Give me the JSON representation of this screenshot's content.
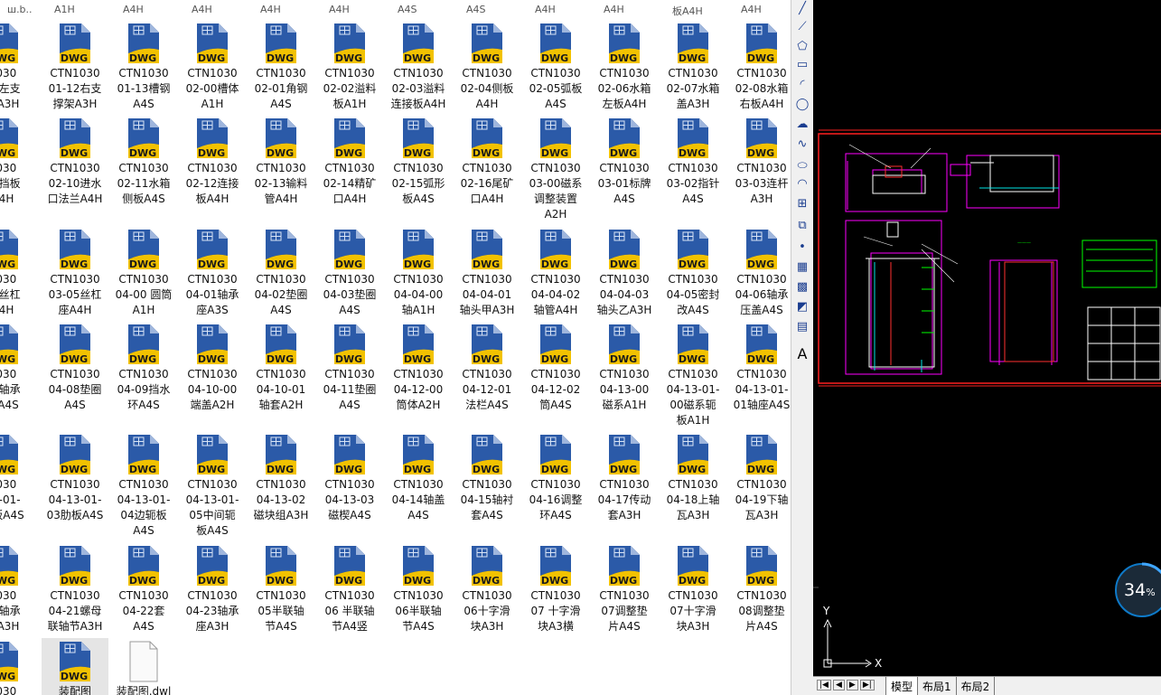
{
  "top_strip": [
    "ш.b..",
    "A1H",
    "A4H",
    "A4H",
    "A4H",
    "A4H",
    "A4S",
    "A4S",
    "A4H",
    "A4H",
    "板A4H",
    "A4H"
  ],
  "files": [
    [
      "1030",
      "11左支",
      "架A3H"
    ],
    [
      "CTN1030",
      "01-12右支",
      "撑架A3H"
    ],
    [
      "CTN1030",
      "01-13槽钢",
      "A4S"
    ],
    [
      "CTN1030",
      "02-00槽体",
      "A1H"
    ],
    [
      "CTN1030",
      "02-01角钢",
      "A4S"
    ],
    [
      "CTN1030",
      "02-02溢料",
      "板A1H"
    ],
    [
      "CTN1030",
      "02-03溢料",
      "连接板A4H"
    ],
    [
      "CTN1030",
      "02-04侧板",
      "A4H"
    ],
    [
      "CTN1030",
      "02-05弧板",
      "A4S"
    ],
    [
      "CTN1030",
      "02-06水箱",
      "左板A4H"
    ],
    [
      "CTN1030",
      "02-07水箱",
      "盖A3H"
    ],
    [
      "CTN1030",
      "02-08水箱",
      "右板A4H"
    ],
    [
      "1030",
      "09挡板",
      "A4H"
    ],
    [
      "CTN1030",
      "02-10进水",
      "口法兰A4H"
    ],
    [
      "CTN1030",
      "02-11水箱",
      "侧板A4S"
    ],
    [
      "CTN1030",
      "02-12连接",
      "板A4H"
    ],
    [
      "CTN1030",
      "02-13输料",
      "管A4H"
    ],
    [
      "CTN1030",
      "02-14精矿",
      "口A4H"
    ],
    [
      "CTN1030",
      "02-15弧形",
      "板A4S"
    ],
    [
      "CTN1030",
      "02-16尾矿",
      "口A4H"
    ],
    [
      "CTN1030",
      "03-00磁系",
      "调整装置",
      "A2H"
    ],
    [
      "CTN1030",
      "03-01标牌",
      "A4S"
    ],
    [
      "CTN1030",
      "03-02指针",
      "A4S"
    ],
    [
      "CTN1030",
      "03-03连杆",
      "A3H"
    ],
    [
      "1030",
      "04丝杠",
      "A4H"
    ],
    [
      "CTN1030",
      "03-05丝杠",
      "座A4H"
    ],
    [
      "CTN1030",
      "04-00 圆筒",
      "A1H"
    ],
    [
      "CTN1030",
      "04-01轴承",
      "座A3S"
    ],
    [
      "CTN1030",
      "04-02垫圈",
      "A4S"
    ],
    [
      "CTN1030",
      "04-03垫圈",
      "A4S"
    ],
    [
      "CTN1030",
      "04-04-00",
      "轴A1H"
    ],
    [
      "CTN1030",
      "04-04-01",
      "轴头甲A3H"
    ],
    [
      "CTN1030",
      "04-04-02",
      "轴管A4H"
    ],
    [
      "CTN1030",
      "04-04-03",
      "轴头乙A3H"
    ],
    [
      "CTN1030",
      "04-05密封",
      "改A4S"
    ],
    [
      "CTN1030",
      "04-06轴承",
      "压盖A4S"
    ],
    [
      "1030",
      "07轴承",
      "套A4S"
    ],
    [
      "CTN1030",
      "04-08垫圈",
      "A4S"
    ],
    [
      "CTN1030",
      "04-09挡水",
      "环A4S"
    ],
    [
      "CTN1030",
      "04-10-00",
      "端盖A2H"
    ],
    [
      "CTN1030",
      "04-10-01",
      "轴套A2H"
    ],
    [
      "CTN1030",
      "04-11垫圈",
      "A4S"
    ],
    [
      "CTN1030",
      "04-12-00",
      "筒体A2H"
    ],
    [
      "CTN1030",
      "04-12-01",
      "法栏A4S"
    ],
    [
      "CTN1030",
      "04-12-02",
      "筒A4S"
    ],
    [
      "CTN1030",
      "04-13-00",
      "磁系A1H"
    ],
    [
      "CTN1030",
      "04-13-01-",
      "00磁系轭",
      "板A1H"
    ],
    [
      "CTN1030",
      "04-13-01-",
      "01轴座A4S"
    ],
    [
      "1030",
      "13-01-",
      "支板A4S"
    ],
    [
      "CTN1030",
      "04-13-01-",
      "03肋板A4S"
    ],
    [
      "CTN1030",
      "04-13-01-",
      "04边轭板",
      "A4S"
    ],
    [
      "CTN1030",
      "04-13-01-",
      "05中间轭",
      "板A4S"
    ],
    [
      "CTN1030",
      "04-13-02",
      "磁块组A3H"
    ],
    [
      "CTN1030",
      "04-13-03",
      "磁楔A4S"
    ],
    [
      "CTN1030",
      "04-14轴盖",
      "A4S"
    ],
    [
      "CTN1030",
      "04-15轴衬",
      "套A4S"
    ],
    [
      "CTN1030",
      "04-16调整",
      "环A4S"
    ],
    [
      "CTN1030",
      "04-17传动",
      "套A3H"
    ],
    [
      "CTN1030",
      "04-18上轴",
      "瓦A3H"
    ],
    [
      "CTN1030",
      "04-19下轴",
      "瓦A3H"
    ],
    [
      "1030",
      "20轴承",
      "盖A3H"
    ],
    [
      "CTN1030",
      "04-21螺母",
      "联轴节A3H"
    ],
    [
      "CTN1030",
      "04-22套",
      "A4S"
    ],
    [
      "CTN1030",
      "04-23轴承",
      "座A3H"
    ],
    [
      "CTN1030",
      "05半联轴",
      "节A4S"
    ],
    [
      "CTN1030",
      "06 半联轴",
      "节A4竖"
    ],
    [
      "CTN1030",
      "06半联轴",
      "节A4S"
    ],
    [
      "CTN1030",
      "06十字滑",
      "块A3H"
    ],
    [
      "CTN1030",
      "07 十字滑",
      "块A3横"
    ],
    [
      "CTN1030",
      "07调整垫",
      "片A4S"
    ],
    [
      "CTN1030",
      "07十字滑",
      "块A3H"
    ],
    [
      "CTN1030",
      "08调整垫",
      "片A4S"
    ],
    [
      "1030"
    ],
    [
      "装配图"
    ],
    [
      "装配图.dwl"
    ]
  ],
  "icon_label": "DWG",
  "cad": {
    "tabs": [
      "模型",
      "布局1",
      "布局2"
    ],
    "axis_x": "X",
    "axis_y": "Y",
    "progress_value": "34",
    "progress_unit": "%"
  },
  "toolbar_icons": [
    "line-icon",
    "polyline-icon",
    "polygon-icon",
    "rectangle-icon",
    "arc-icon",
    "circle-icon",
    "cloud-icon",
    "spline-icon",
    "ellipse-icon",
    "ellipse-arc-icon",
    "insert-block-icon",
    "make-block-icon",
    "point-icon",
    "hatch-icon",
    "gradient-icon",
    "region-icon",
    "table-icon",
    "text-icon"
  ],
  "colors": {
    "cad_bg": "#000000",
    "magenta": "#ff00ff",
    "accent": "#1e7fd6"
  }
}
